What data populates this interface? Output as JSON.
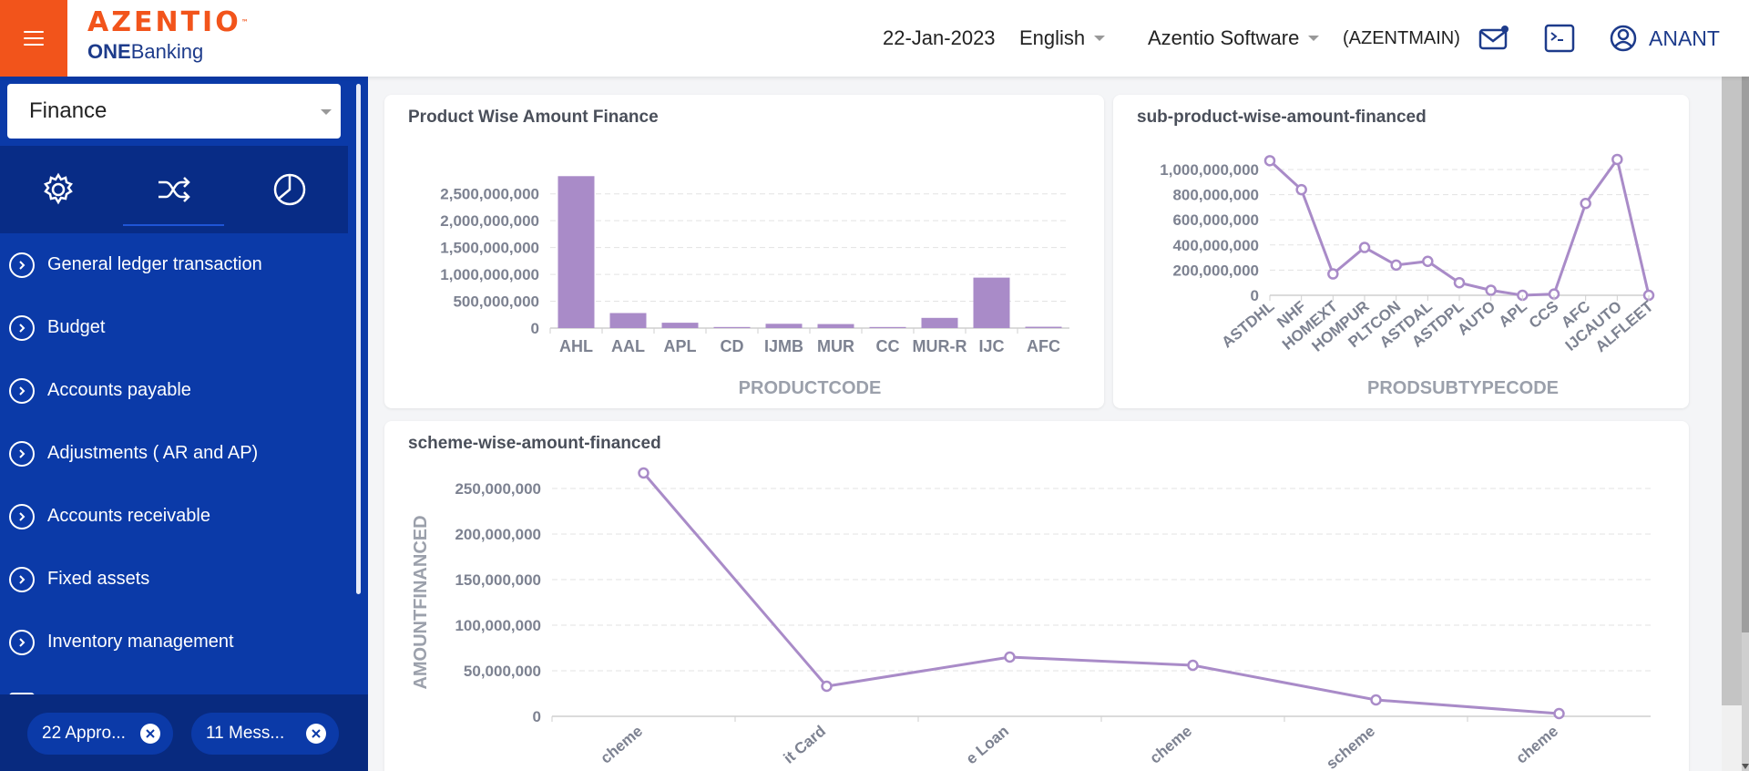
{
  "app": {
    "logo_main": "AZENTIO",
    "logo_tm": "™",
    "logo_sub_bold": "ONE",
    "logo_sub_rest": "Banking"
  },
  "header": {
    "date": "22-Jan-2023",
    "language": "English",
    "company": "Azentio Software",
    "branch": "(AZENTMAIN)",
    "user": "ANANT"
  },
  "sidebar": {
    "module": "Finance",
    "tabs": [
      {
        "icon": "gear-icon"
      },
      {
        "icon": "shuffle-icon"
      },
      {
        "icon": "pie-chart-icon"
      }
    ],
    "items": [
      {
        "label": "General ledger transaction"
      },
      {
        "label": "Budget"
      },
      {
        "label": "Accounts payable"
      },
      {
        "label": "Adjustments ( AR and AP)"
      },
      {
        "label": "Accounts receivable"
      },
      {
        "label": "Fixed assets"
      },
      {
        "label": "Inventory management"
      }
    ],
    "chips": [
      {
        "label": "22 Appro..."
      },
      {
        "label": "11 Mess..."
      }
    ]
  },
  "colors": {
    "accent": "#f2541b",
    "sidebar": "#0b3aa8",
    "series": "#a98bc8",
    "axis_text": "#7d8291"
  },
  "chart_data": [
    {
      "type": "bar",
      "title": "Product Wise Amount Finance",
      "xlabel": "PRODUCTCODE",
      "ylabel": "",
      "categories": [
        "AHL",
        "AAL",
        "APL",
        "CD",
        "IJMB",
        "MUR",
        "CC",
        "MUR-R",
        "IJC",
        "AFC"
      ],
      "values": [
        2830000000,
        280000000,
        100000000,
        20000000,
        80000000,
        75000000,
        20000000,
        190000000,
        940000000,
        25000000
      ],
      "ylim": [
        0,
        2750000000
      ],
      "yticks": [
        0,
        500000000,
        1000000000,
        1500000000,
        2000000000,
        2500000000
      ],
      "ytick_labels": [
        "0",
        "500,000,000",
        "1,000,000,000",
        "1,500,000,000",
        "2,000,000,000",
        "2,500,000,000"
      ],
      "grid": true
    },
    {
      "type": "line",
      "title": "sub-product-wise-amount-financed",
      "xlabel": "PRODSUBTYPECODE",
      "ylabel": "",
      "categories": [
        "ASTDHL",
        "NHF",
        "HOMEXT",
        "HOMPUR",
        "PLTCON",
        "ASTDAL",
        "ASTDPL",
        "AUTO",
        "APL",
        "CCS",
        "AFC",
        "IJCAUTO",
        "ALFLEET"
      ],
      "values": [
        1070000000,
        840000000,
        170000000,
        380000000,
        240000000,
        270000000,
        100000000,
        40000000,
        0,
        10000000,
        730000000,
        1080000000,
        0
      ],
      "ylim": [
        0,
        1000000000
      ],
      "yticks": [
        0,
        200000000,
        400000000,
        600000000,
        800000000,
        1000000000
      ],
      "ytick_labels": [
        "0",
        "200,000,000",
        "400,000,000",
        "600,000,000",
        "800,000,000",
        "1,000,000,000"
      ],
      "grid": true
    },
    {
      "type": "line",
      "title": "scheme-wise-amount-financed",
      "xlabel": "",
      "ylabel": "AMOUNTFINANCED",
      "categories": [
        "cheme",
        "it Card",
        "e Loan",
        "cheme",
        "scheme",
        "cheme"
      ],
      "values": [
        267000000,
        33000000,
        65000000,
        56000000,
        18000000,
        3000000
      ],
      "ylim": [
        0,
        250000000
      ],
      "yticks": [
        0,
        50000000,
        100000000,
        150000000,
        200000000,
        250000000
      ],
      "ytick_labels": [
        "0",
        "50,000,000",
        "100,000,000",
        "150,000,000",
        "200,000,000",
        "250,000,000"
      ],
      "grid": true
    }
  ]
}
